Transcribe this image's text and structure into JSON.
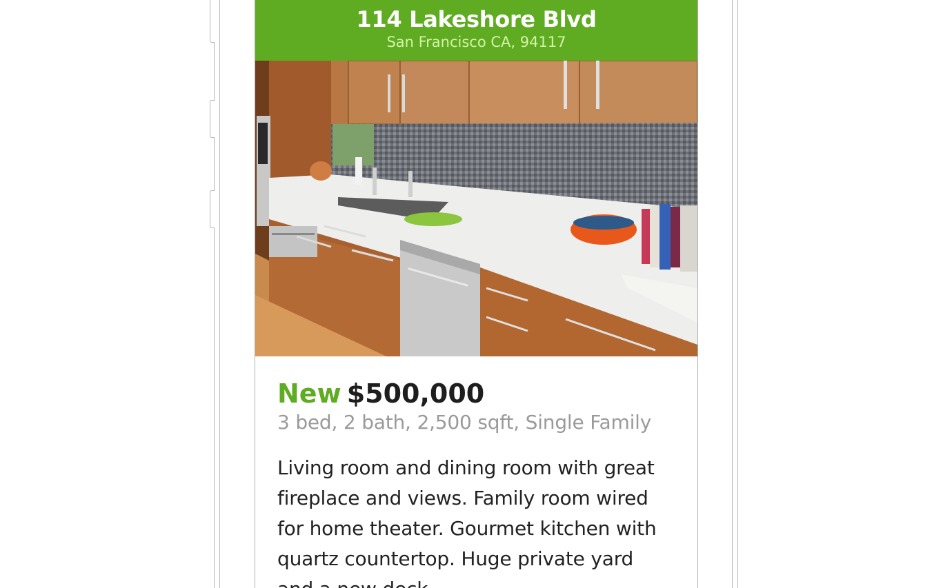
{
  "listing": {
    "address": "114 Lakeshore Blvd",
    "city_line": "San Francisco CA, 94117",
    "status_badge": "New",
    "price": "$500,000",
    "facts": "3 bed, 2 bath, 2,500 sqft, Single Family",
    "description": "Living room and dining room with great fireplace and views. Family room wired for home theater. Gourmet kitchen with quartz countertop. Huge private yard and a new deck."
  },
  "colors": {
    "brand_green": "#5fac22",
    "city_text": "#d4f3a8",
    "facts_text": "#9a9a9a",
    "body_text": "#222222"
  }
}
